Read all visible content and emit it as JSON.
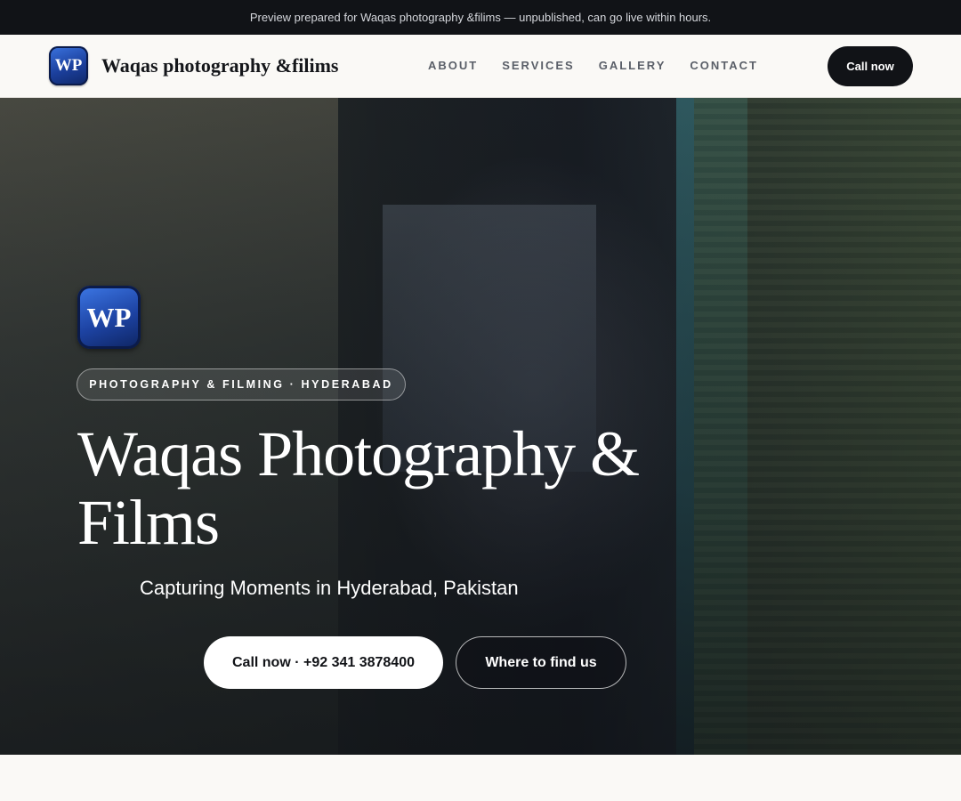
{
  "preview_banner": {
    "text": "Preview prepared for Waqas photography &filims — unpublished, can go live within hours."
  },
  "header": {
    "logo_text": "WP",
    "brand_name": "Waqas photography &filims",
    "nav": [
      {
        "label": "ABOUT"
      },
      {
        "label": "SERVICES"
      },
      {
        "label": "GALLERY"
      },
      {
        "label": "CONTACT"
      }
    ],
    "cta_label": "Call now"
  },
  "hero": {
    "logo_text": "WP",
    "tagline": "PHOTOGRAPHY & FILMING · HYDERABAD",
    "title": "Waqas Photography & Films",
    "subtitle": "Capturing Moments in Hyderabad, Pakistan",
    "primary_button": "Call now · +92 341 3878400",
    "secondary_button": "Where to find us"
  },
  "colors": {
    "topbar_bg": "#111317",
    "page_bg": "#faf9f6",
    "logo_blue": "#1b3f9c",
    "dark_button": "#111317",
    "nav_text": "#5a5f68"
  }
}
